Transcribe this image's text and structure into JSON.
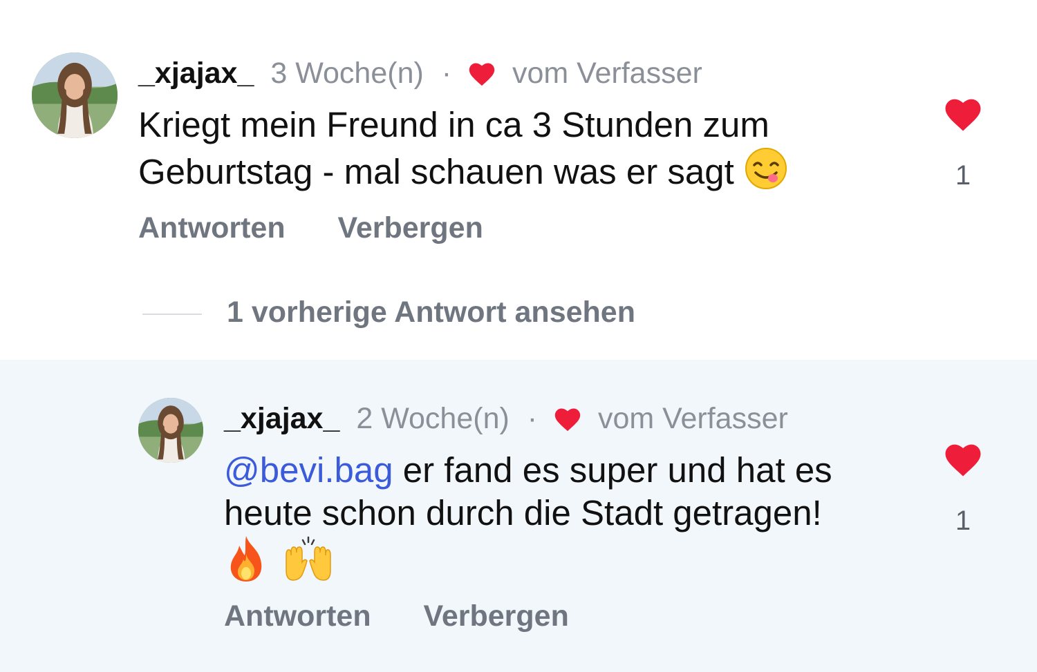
{
  "comments": [
    {
      "username": "_xjajax_",
      "time": "3 Woche(n)",
      "separator": "·",
      "author_liked_label": "vom Verfasser",
      "text_line1": "Kriegt mein Freund in ca 3 Stunden zum",
      "text_line2": "Geburtstag - mal schauen was er sagt",
      "emoji": "yum-face-icon",
      "reply_label": "Antworten",
      "hide_label": "Verbergen",
      "like_count": "1"
    },
    {
      "username": "_xjajax_",
      "time": "2 Woche(n)",
      "separator": "·",
      "author_liked_label": "vom Verfasser",
      "mention": "@bevi.bag",
      "text_line1": " er fand es super und hat es",
      "text_line2": "heute schon durch die Stadt getragen!",
      "emojis": [
        "fire-icon",
        "raising-hands-icon"
      ],
      "reply_label": "Antworten",
      "hide_label": "Verbergen",
      "like_count": "1"
    }
  ],
  "view_previous": "1 vorherige Antwort ansehen",
  "colors": {
    "heart": "#ee1d3a",
    "mention": "#3b5bdb",
    "muted": "#8a8f98",
    "reply_background": "#f2f7fb"
  }
}
